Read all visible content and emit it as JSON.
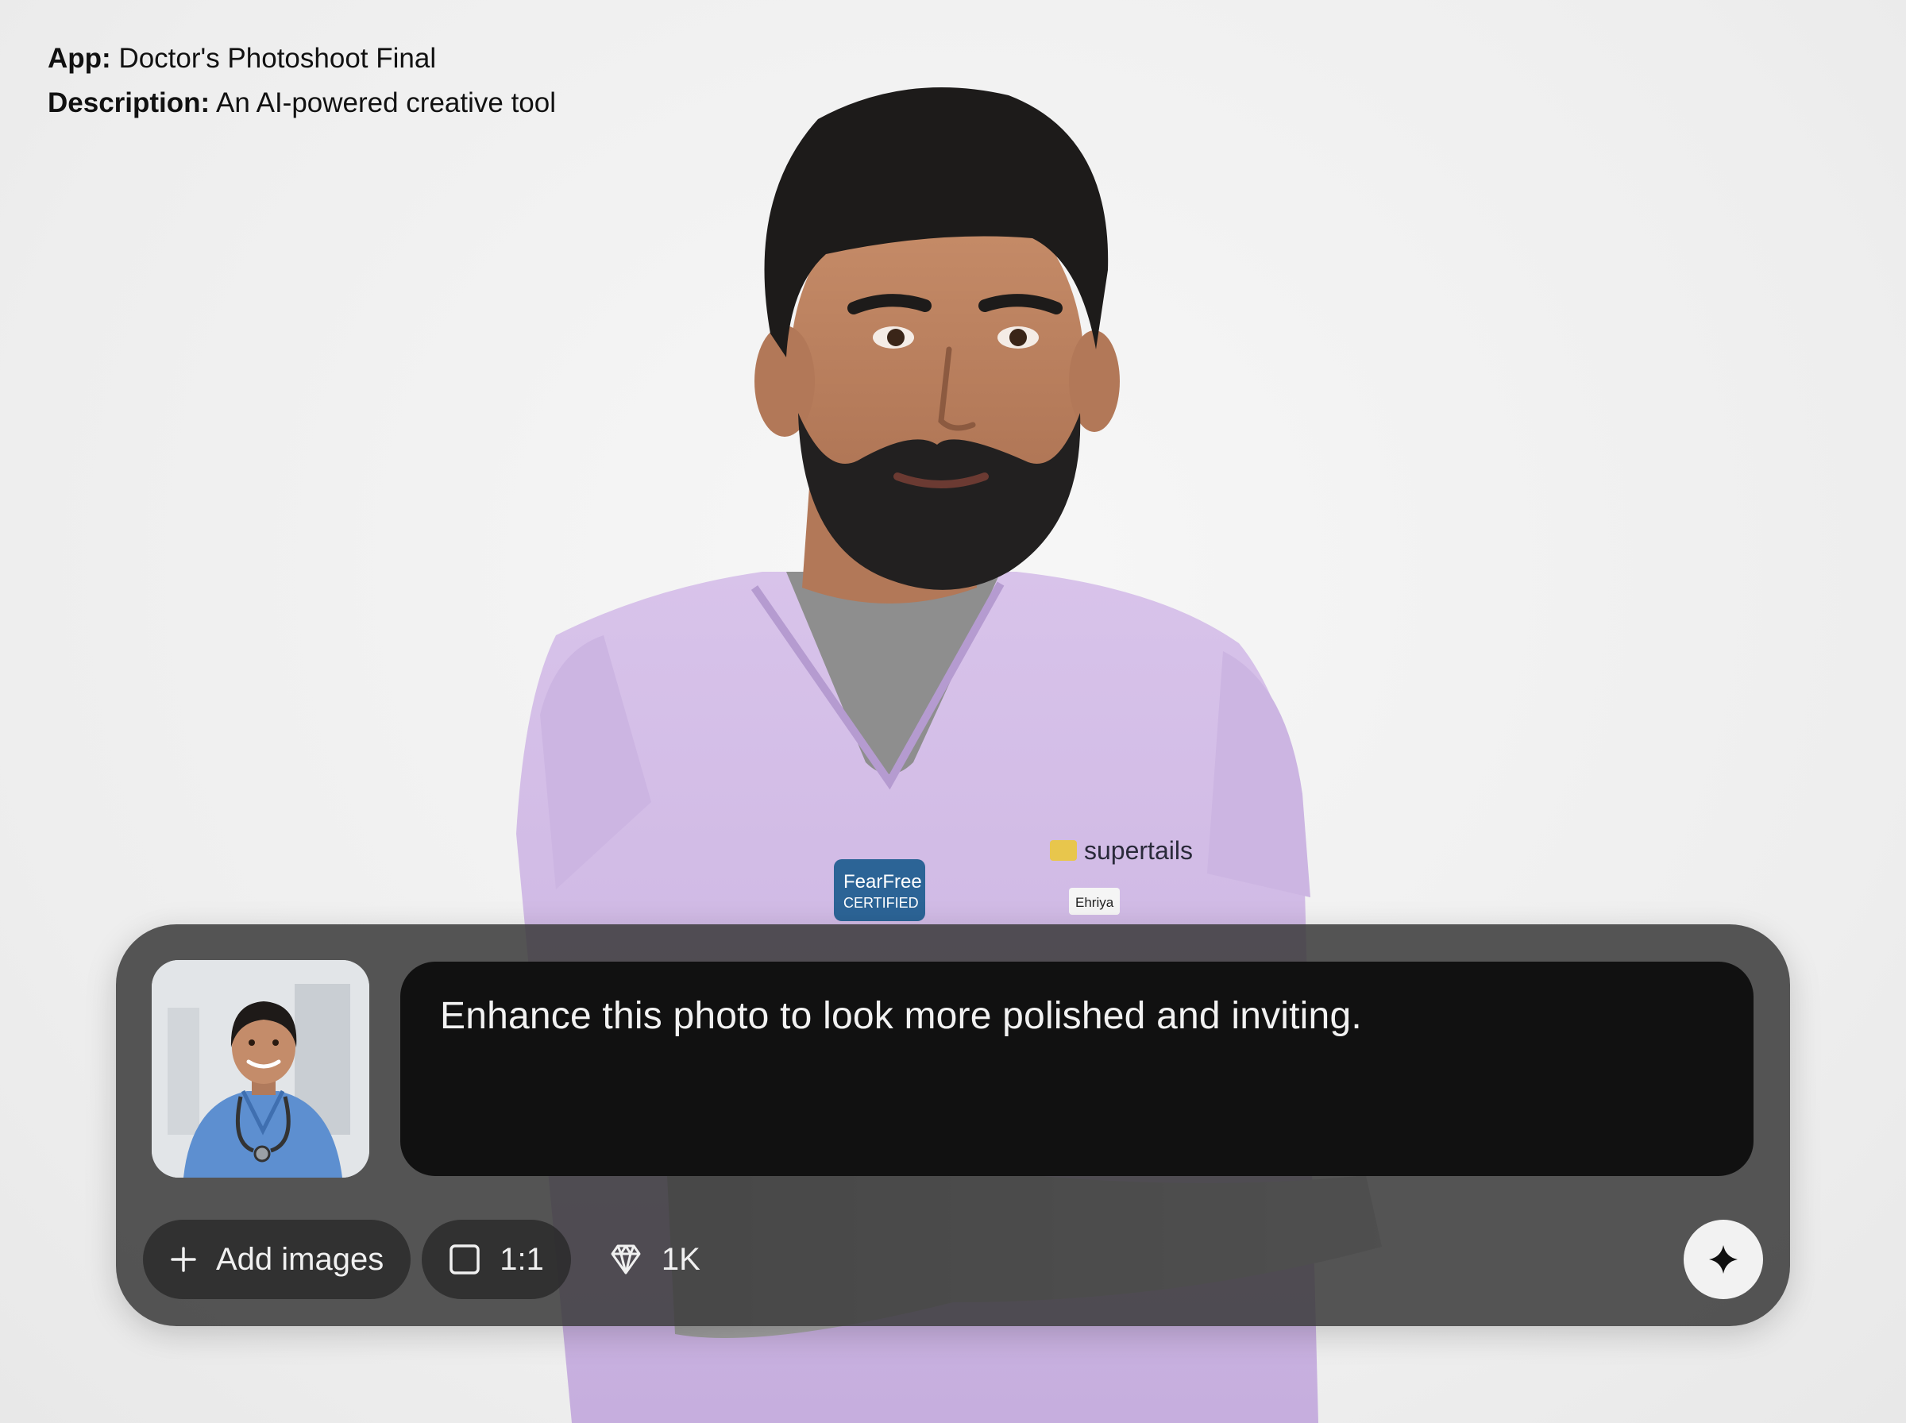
{
  "app": {
    "app_key": "App:",
    "app_value": "Doctor's Photoshoot Final",
    "desc_key": "Description:",
    "desc_value": "An AI-powered creative tool"
  },
  "background_photo": {
    "chest_logo_text": "supertails",
    "name_tag": "Ehriya",
    "badge_line1": "FearFree",
    "badge_line2": "CERTIFIED"
  },
  "composer": {
    "prompt": "Enhance this photo to look more polished and inviting.",
    "add_images_label": "Add images",
    "aspect_label": "1:1",
    "resolution_label": "1K",
    "icons": {
      "add": "plus-icon",
      "aspect": "square-icon",
      "resolution": "diamond-icon",
      "send": "sparkle-icon"
    }
  }
}
